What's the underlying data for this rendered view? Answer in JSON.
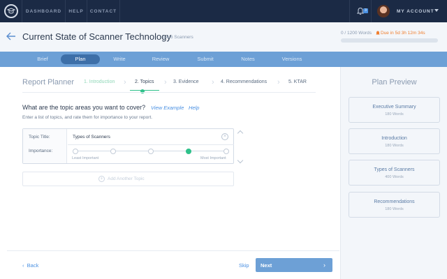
{
  "nav": {
    "links": [
      "DASHBOARD",
      "HELP",
      "CONTACT"
    ],
    "notification_count": "3",
    "account_label": "MY ACCOUNT"
  },
  "header": {
    "title": "Current State of Scanner Technology",
    "subtitle": "1.4.6 Scanners",
    "word_count": "0 / 1200 Words",
    "due": "Due in 5d 3h 12m 34s",
    "progress": 0
  },
  "tabs": [
    "Brief",
    "Plan",
    "Write",
    "Review",
    "Submit",
    "Notes",
    "Versions"
  ],
  "active_tab": "Plan",
  "planner": {
    "title": "Report Planner",
    "steps": [
      "1. Introduction",
      "2. Topics",
      "3. Evidence",
      "4. Recommendations",
      "5. KTAR"
    ],
    "current_step": "2. Topics",
    "question": "What are the topic areas you want to cover?",
    "view_example": "View Example",
    "help": "Help",
    "hint": "Enter a list of topics, and rate them for importance to your report.",
    "topic": {
      "title_label": "Topic Title:",
      "title_value": "Types of Scanners",
      "importance_label": "Importance:",
      "importance_levels": 5,
      "importance_selected": 4,
      "min_label": "Least Important",
      "max_label": "Most Important"
    },
    "add_topic": "Add Another Topic"
  },
  "footer": {
    "back": "Back",
    "skip": "Skip",
    "next": "Next"
  },
  "preview": {
    "title": "Plan Preview",
    "sections": [
      {
        "title": "Executive Summary",
        "words": "180 Words"
      },
      {
        "title": "Introduction",
        "words": "180 Words"
      },
      {
        "title": "Types of Scanners",
        "words": "400 Words"
      },
      {
        "title": "Recommendations",
        "words": "180 Words"
      }
    ]
  },
  "colors": {
    "nav_bg": "#1b2a45",
    "tab_bar": "#6da0d6",
    "active_tab": "#3d6fa8",
    "accent_green": "#2ec18a",
    "link_blue": "#4a90e2",
    "due_orange": "#f07f2f"
  },
  "icons": [
    "logo-icon",
    "bell-icon",
    "back-arrow-icon",
    "clear-icon",
    "chevron-up-icon",
    "chevron-down-icon",
    "plus-icon",
    "chevron-left-icon",
    "chevron-right-icon",
    "clock-icon"
  ]
}
